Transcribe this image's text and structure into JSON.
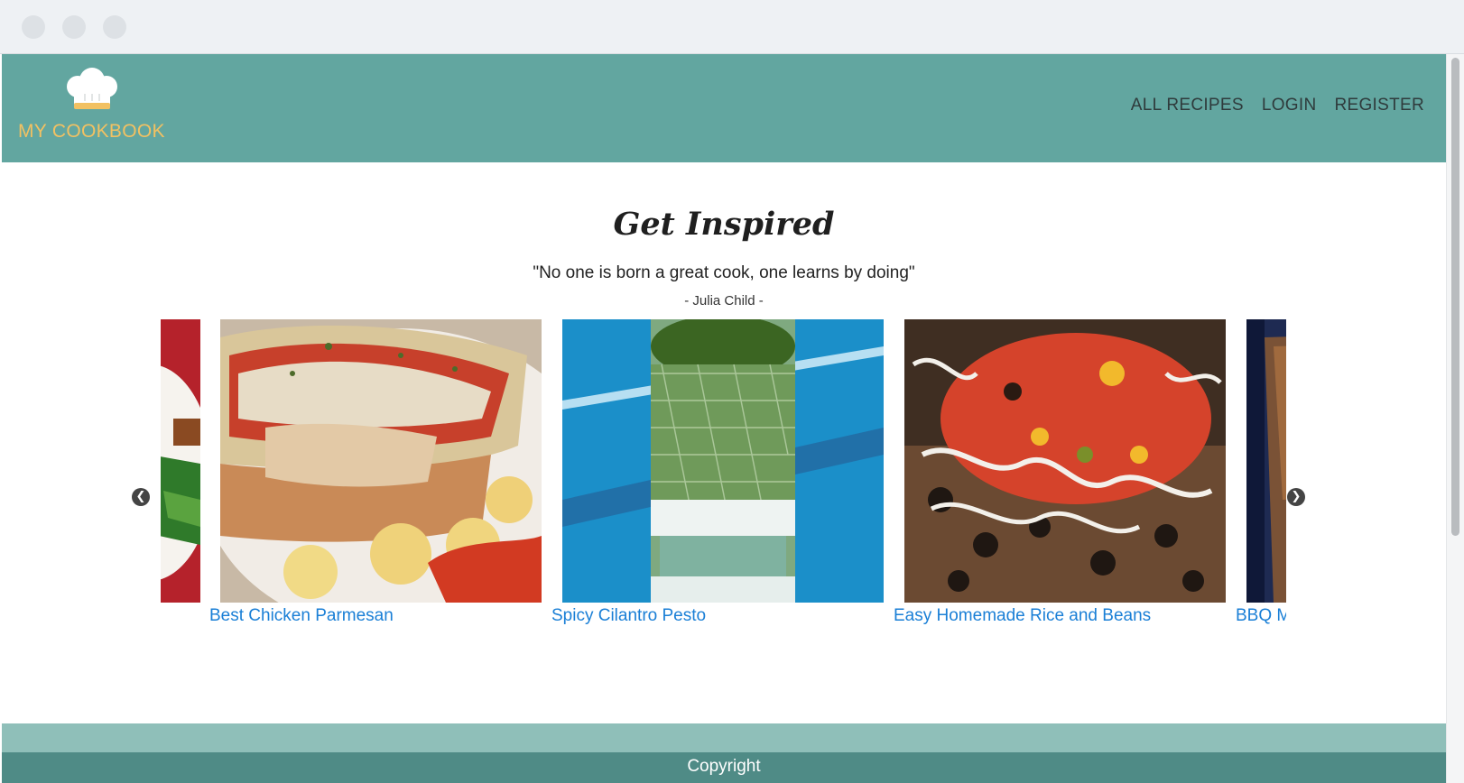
{
  "brand": {
    "name": "MY COOKBOOK",
    "logo_icon": "chef-hat-icon",
    "colors": {
      "header": "#62a6a0",
      "logo_text": "#f2c162",
      "link": "#1a7fd6",
      "footer": "#4f8b86"
    }
  },
  "nav": {
    "items": [
      {
        "label": "ALL RECIPES"
      },
      {
        "label": "LOGIN"
      },
      {
        "label": "REGISTER"
      }
    ]
  },
  "hero": {
    "title": "Get Inspired",
    "quote": "\"No one is born a great cook, one learns by doing\"",
    "author": "- Julia Child -"
  },
  "carousel": {
    "prev_icon": "chevron-left-icon",
    "next_icon": "chevron-right-icon",
    "slides": [
      {
        "title": "Best Chicken Parmesan"
      },
      {
        "title": "Spicy Cilantro Pesto"
      },
      {
        "title": "Easy Homemade Rice and Beans"
      },
      {
        "title": "BBQ M"
      }
    ]
  },
  "footer": {
    "text": "Copyright"
  }
}
